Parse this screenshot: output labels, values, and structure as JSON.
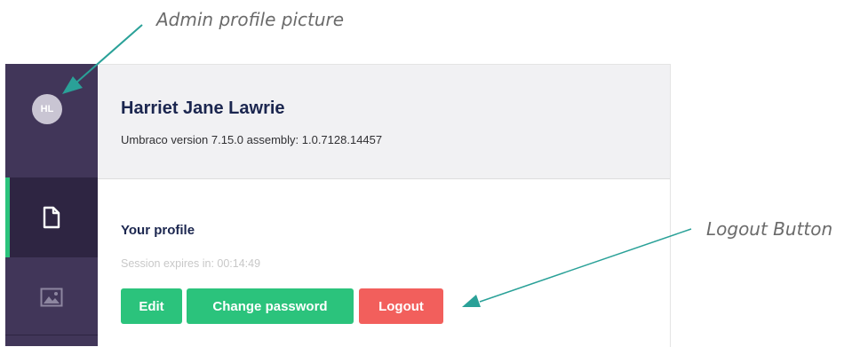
{
  "annotations": {
    "avatar_note": "Admin profile picture",
    "logout_note": "Logout Button"
  },
  "sidebar": {
    "avatar_initials": "HL",
    "items": [
      {
        "name": "content",
        "icon": "document-icon",
        "active": true
      },
      {
        "name": "media",
        "icon": "image-icon",
        "active": false
      }
    ]
  },
  "profile": {
    "user_name": "Harriet Jane Lawrie",
    "version_text": "Umbraco version 7.15.0 assembly: 1.0.7128.14457",
    "section_title": "Your profile",
    "session_text": "Session expires in: 00:14:49"
  },
  "buttons": {
    "edit": "Edit",
    "change_password": "Change password",
    "logout": "Logout"
  },
  "colors": {
    "sidebar_bg": "#413659",
    "active_section_bg": "#2e2542",
    "accent_green": "#2bc37c",
    "logout_red": "#f25f5c",
    "arrow_teal": "#2aa198"
  }
}
